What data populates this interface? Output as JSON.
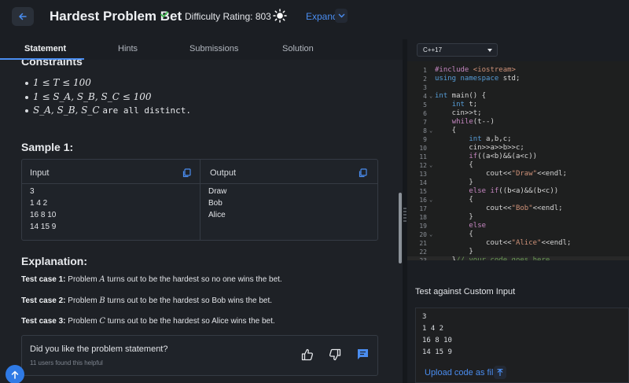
{
  "header": {
    "title": "Hardest Problem Bet",
    "difficulty": "Difficulty Rating: 803",
    "expand_label": "Expand"
  },
  "tabs": [
    {
      "label": "Statement"
    },
    {
      "label": "Hints"
    },
    {
      "label": "Submissions"
    },
    {
      "label": "Solution"
    }
  ],
  "constraints": {
    "heading": "Constraints",
    "items": [
      "1 ≤ T ≤ 100",
      "1 ≤ S_A, S_B, S_C ≤ 100",
      "are all distinct."
    ],
    "item3_vars": "S_A, S_B, S_C"
  },
  "sample": {
    "heading": "Sample 1:",
    "input_label": "Input",
    "output_label": "Output",
    "input_lines": [
      "3",
      "1 4 2",
      "16 8 10",
      "14 15 9"
    ],
    "output_lines": [
      "Draw",
      "Bob",
      "Alice"
    ]
  },
  "explanation": {
    "heading": "Explanation:",
    "cases": [
      {
        "label": "Test case 1:",
        "var": "A",
        "pre": "Problem",
        "post": "turns out to be the hardest so no one wins the bet."
      },
      {
        "label": "Test case 2:",
        "var": "B",
        "pre": "Problem",
        "post": "turns out to be the hardest so Bob wins the bet."
      },
      {
        "label": "Test case 3:",
        "var": "C",
        "pre": "Problem",
        "post": "turns out to be the hardest so Alice wins the bet."
      }
    ]
  },
  "feedback": {
    "question": "Did you like the problem statement?",
    "count": "11 users found this helpful"
  },
  "editor": {
    "language": "C++17",
    "lines": [
      "#include <iostream>",
      "using namespace std;",
      "",
      "int main() {",
      "    int t;",
      "    cin>>t;",
      "    while(t--)",
      "    {",
      "        int a,b,c;",
      "        cin>>a>>b>>c;",
      "        if((a<b)&&(a<c))",
      "        {",
      "            cout<<\"Draw\"<<endl;",
      "        }",
      "        else if((b<a)&&(b<c))",
      "        {",
      "            cout<<\"Bob\"<<endl;",
      "        }",
      "        else",
      "        {",
      "            cout<<\"Alice\"<<endl;",
      "        }",
      "    }// your code goes here"
    ],
    "line_numbers": [
      "1",
      "2",
      "3",
      "4",
      "5",
      "6",
      "7",
      "8",
      "9",
      "10",
      "11",
      "12",
      "13",
      "14",
      "15",
      "16",
      "17",
      "18",
      "19",
      "20",
      "21",
      "22",
      "23"
    ]
  },
  "custom_input": {
    "heading": "Test against Custom Input",
    "lines": [
      "3",
      "1 4 2",
      "16 8 10",
      "14 15 9"
    ],
    "upload_label": "Upload code as file"
  },
  "colors": {
    "accent": "#4a8df0",
    "success": "#3fb950",
    "background": "#1e2126"
  }
}
